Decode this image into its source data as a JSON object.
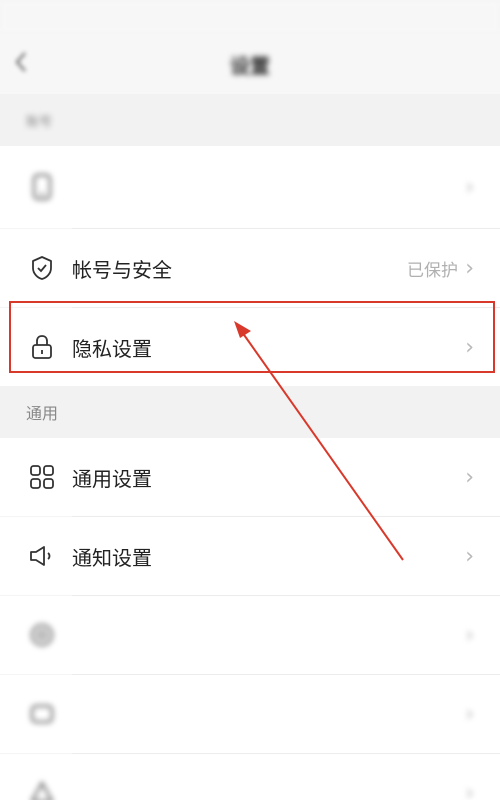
{
  "status_bar": {
    "left": "",
    "time": "",
    "right": ""
  },
  "header": {
    "title": "设置"
  },
  "sections": {
    "account_label": "账号",
    "general_label": "通用"
  },
  "rows": {
    "phone": {
      "label": "",
      "value": ""
    },
    "account_security": {
      "label": "帐号与安全",
      "value": "已保护"
    },
    "privacy": {
      "label": "隐私设置"
    },
    "general_settings": {
      "label": "通用设置"
    },
    "notification_settings": {
      "label": "通知设置"
    },
    "row6": {
      "label": ""
    },
    "row7": {
      "label": ""
    },
    "row8": {
      "label": ""
    }
  },
  "colors": {
    "highlight": "#d8392b",
    "arrow": "#d8392b"
  },
  "icons": {
    "back": "chevron-left-icon",
    "shield": "shield-check-icon",
    "lock": "lock-icon",
    "grid": "grid-icon",
    "speaker": "speaker-icon"
  }
}
